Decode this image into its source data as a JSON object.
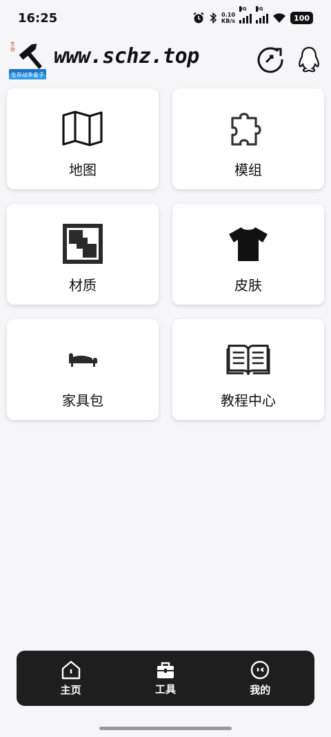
{
  "status": {
    "time": "16:25",
    "net_speed_value": "0.10",
    "net_speed_unit": "KB/s",
    "sim1": "5G",
    "sim2": "5G",
    "battery": "100"
  },
  "header": {
    "site_title": "www.schz.top",
    "logo_icon": "hammer-logo",
    "logo_caption": "生存战争盒子",
    "refresh_icon": "refresh-icon",
    "qq_icon": "qq-penguin-icon"
  },
  "cards": [
    {
      "label": "地图",
      "icon": "map-icon"
    },
    {
      "label": "模组",
      "icon": "puzzle-icon"
    },
    {
      "label": "材质",
      "icon": "texture-icon"
    },
    {
      "label": "皮肤",
      "icon": "tshirt-icon"
    },
    {
      "label": "家具包",
      "icon": "sofa-icon"
    },
    {
      "label": "教程中心",
      "icon": "book-icon"
    }
  ],
  "bottom_nav": [
    {
      "label": "主页",
      "icon": "home-icon"
    },
    {
      "label": "工具",
      "icon": "toolbox-icon"
    },
    {
      "label": "我的",
      "icon": "profile-face-icon"
    }
  ]
}
